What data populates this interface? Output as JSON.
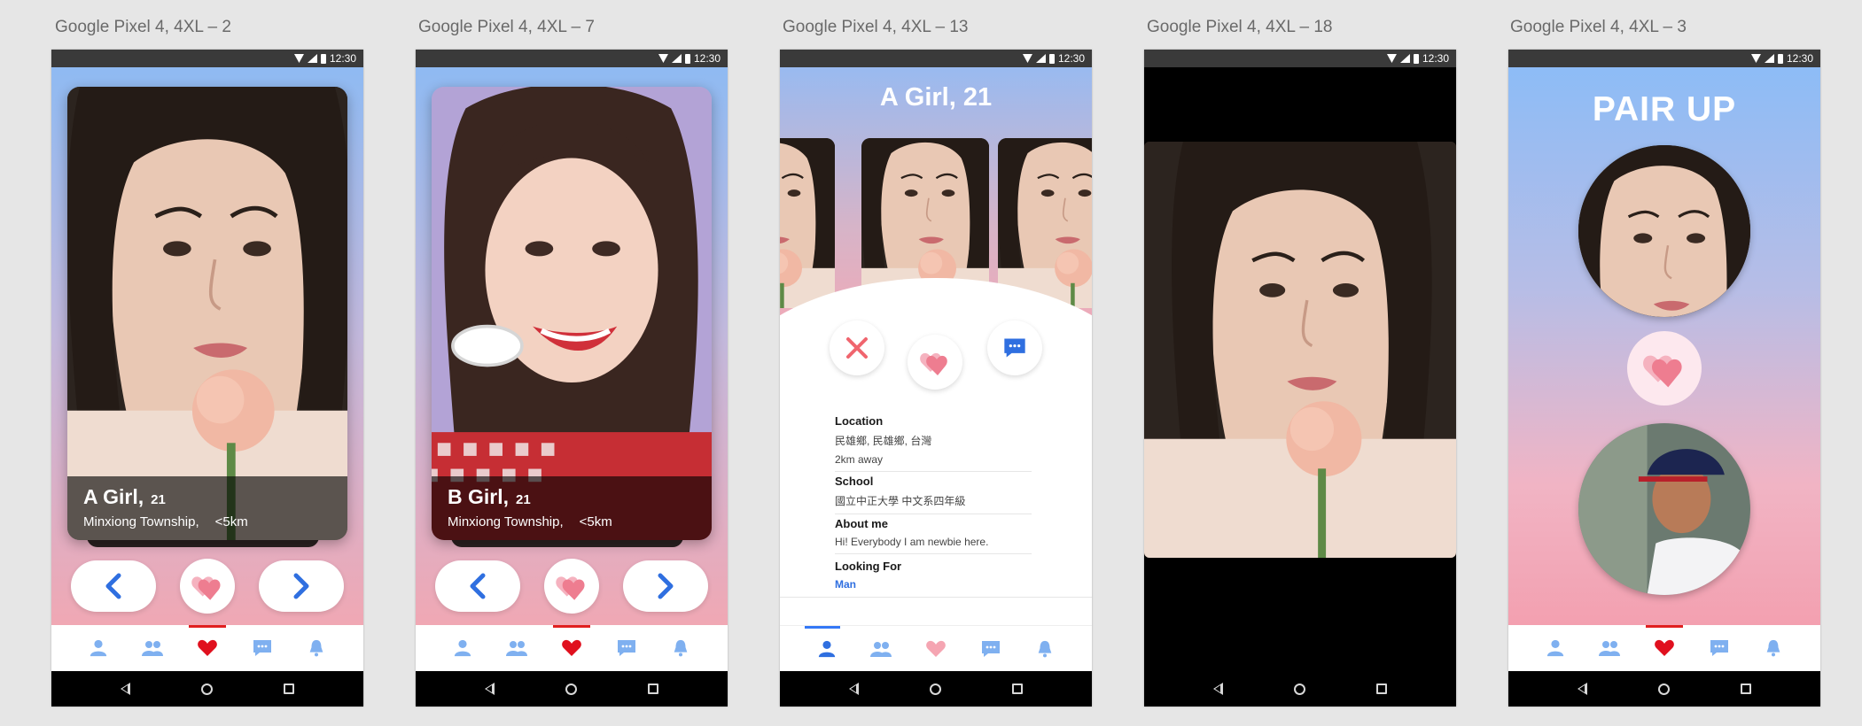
{
  "artboards": [
    {
      "label": "Google Pixel 4, 4XL – 2"
    },
    {
      "label": "Google Pixel 4, 4XL – 7"
    },
    {
      "label": "Google Pixel 4, 4XL – 13"
    },
    {
      "label": "Google Pixel 4, 4XL – 18"
    },
    {
      "label": "Google Pixel 4, 4XL – 3"
    }
  ],
  "status_time": "12:30",
  "cards": [
    {
      "name": "A Girl,",
      "age": "21",
      "location": "Minxiong Township,",
      "distance": "<5km"
    },
    {
      "name": "B Girl,",
      "age": "21",
      "location": "Minxiong Township,",
      "distance": "<5km"
    }
  ],
  "profile": {
    "title": "A Girl, 21",
    "location_label": "Location",
    "location_value": "民雄鄉, 民雄鄉, 台灣",
    "distance": "2km away",
    "school_label": "School",
    "school_value": "國立中正大學 中文系四年級",
    "about_label": "About me",
    "about_value": "Hi! Everybody I am newbie here.",
    "looking_label": "Looking For",
    "looking_value": "Man"
  },
  "match": {
    "title": "PAIR UP"
  },
  "icons": {
    "tabs": [
      "profile-icon",
      "friends-icon",
      "heart-icon",
      "chat-icon",
      "bell-icon"
    ],
    "actions": [
      "back-arrow-icon",
      "like-heart-icon",
      "next-arrow-icon",
      "dislike-x-icon",
      "message-icon"
    ]
  },
  "colors": {
    "tab_icon": "#7fb0f0",
    "tab_active": "#e0101e",
    "accent_blue": "#2f6fe0",
    "heart_pink": "#f08a9c",
    "dislike_red": "#f0656e"
  }
}
